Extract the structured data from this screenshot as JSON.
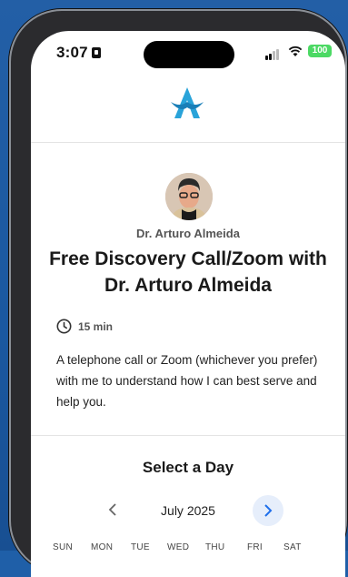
{
  "status_bar": {
    "time": "3:07",
    "battery": "100"
  },
  "event": {
    "host_name": "Dr. Arturo Almeida",
    "title": "Free Discovery Call/Zoom with Dr. Arturo Almeida",
    "duration": "15 min",
    "description": "A telephone call or Zoom (whichever you prefer) with me to understand how I can best serve and help you."
  },
  "calendar": {
    "heading": "Select a Day",
    "month": "July 2025",
    "weekdays": [
      "SUN",
      "MON",
      "TUE",
      "WED",
      "THU",
      "FRI",
      "SAT"
    ]
  },
  "colors": {
    "accent": "#1f6feb",
    "logo": "#29a3d9",
    "battery": "#4cd964",
    "background": "#1f5fa8"
  },
  "icons": {
    "clock": "clock-icon",
    "prev": "chevron-left-icon",
    "next": "chevron-right-icon"
  }
}
